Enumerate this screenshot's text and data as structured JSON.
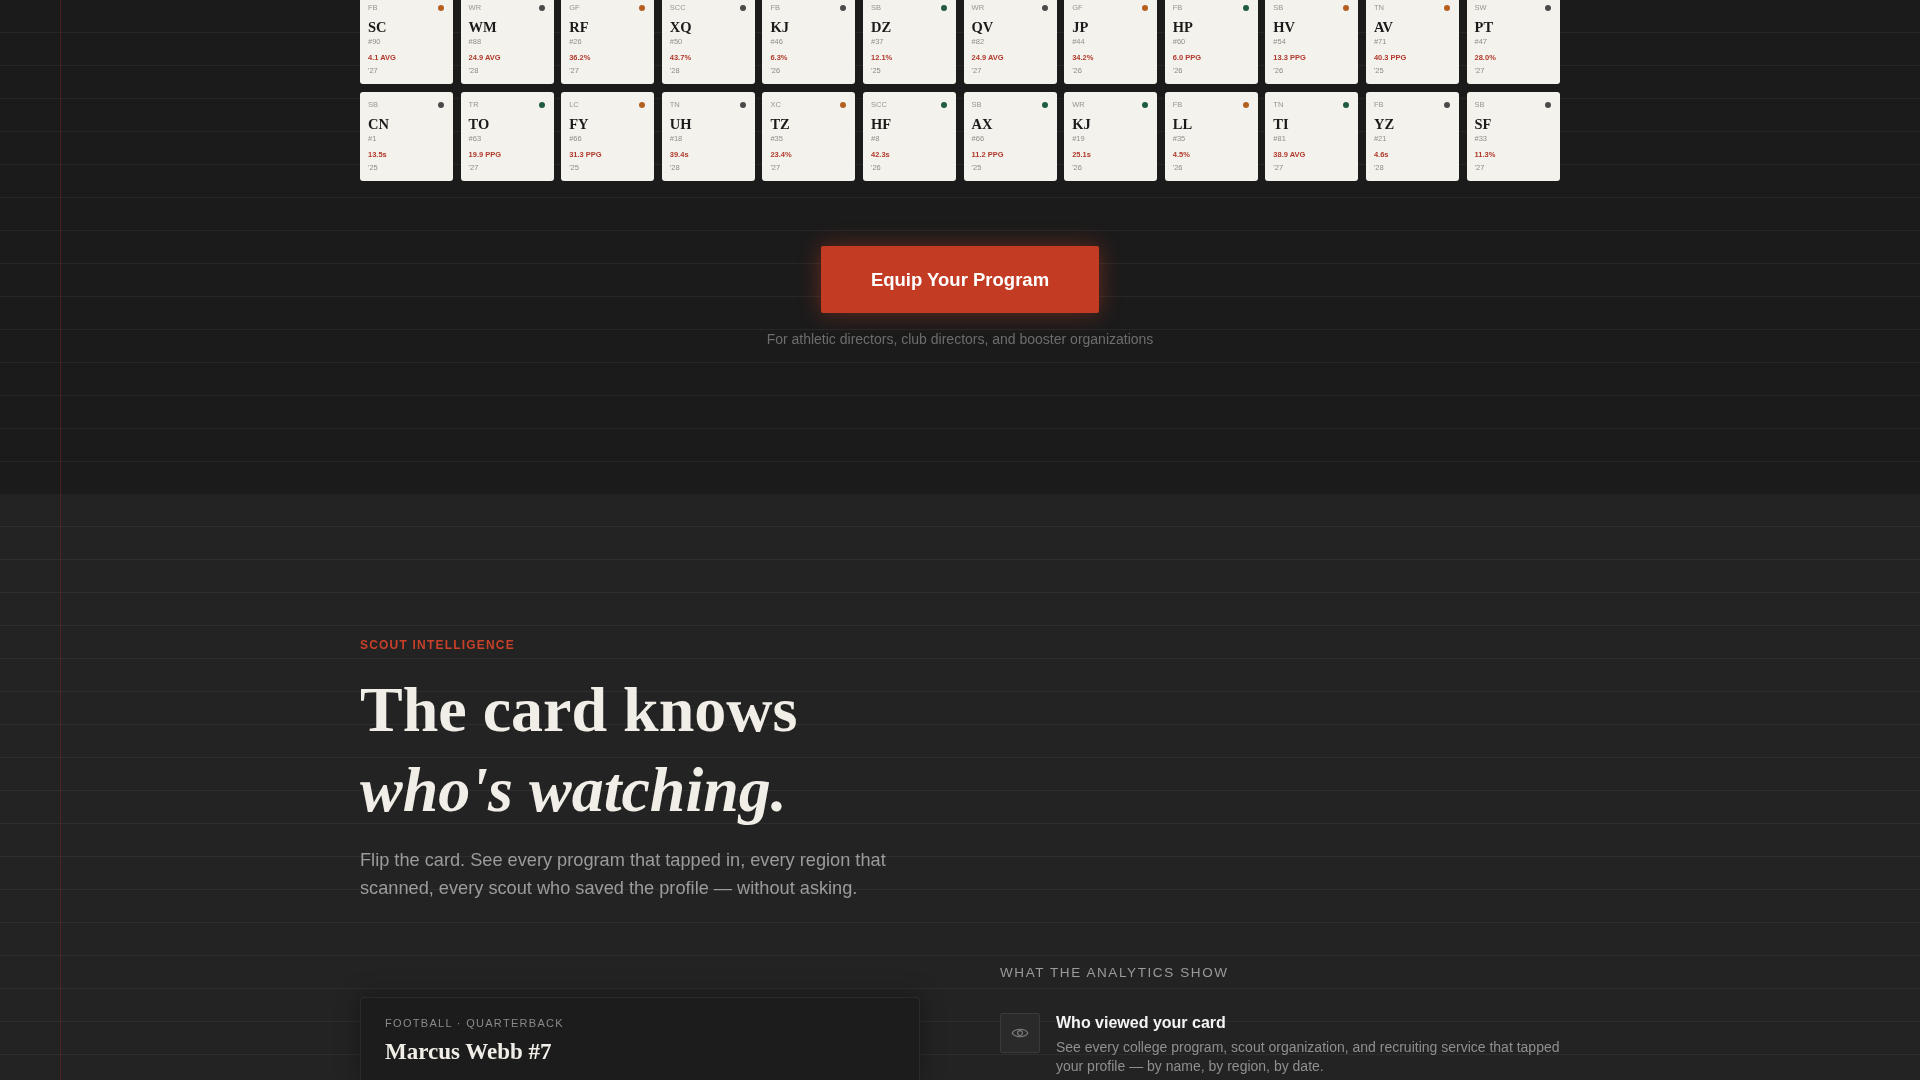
{
  "roster_cards": [
    {
      "sport": "FB",
      "initials": "SC",
      "number": "#90",
      "stat": "4.1 AVG",
      "class_year": "'27",
      "color": "#b5601f"
    },
    {
      "sport": "WR",
      "initials": "WM",
      "number": "#88",
      "stat": "24.9 AVG",
      "class_year": "'28",
      "color": "#4a4a4a"
    },
    {
      "sport": "GF",
      "initials": "RF",
      "number": "#26",
      "stat": "36.2%",
      "class_year": "'27",
      "color": "#b5601f"
    },
    {
      "sport": "SCC",
      "initials": "XQ",
      "number": "#50",
      "stat": "43.7%",
      "class_year": "'28",
      "color": "#4a4a4a"
    },
    {
      "sport": "FB",
      "initials": "KJ",
      "number": "#46",
      "stat": "6.3%",
      "class_year": "'26",
      "color": "#4a4a4a"
    },
    {
      "sport": "SB",
      "initials": "DZ",
      "number": "#37",
      "stat": "12.1%",
      "class_year": "'25",
      "color": "#1f5c3f"
    },
    {
      "sport": "WR",
      "initials": "QV",
      "number": "#82",
      "stat": "24.9 AVG",
      "class_year": "'27",
      "color": "#4a4a4a"
    },
    {
      "sport": "GF",
      "initials": "JP",
      "number": "#44",
      "stat": "34.2%",
      "class_year": "'26",
      "color": "#b5601f"
    },
    {
      "sport": "FB",
      "initials": "HP",
      "number": "#60",
      "stat": "6.0 PPG",
      "class_year": "'26",
      "color": "#1f5c3f"
    },
    {
      "sport": "SB",
      "initials": "HV",
      "number": "#54",
      "stat": "13.3 PPG",
      "class_year": "'26",
      "color": "#b5601f"
    },
    {
      "sport": "TN",
      "initials": "AV",
      "number": "#71",
      "stat": "40.3 PPG",
      "class_year": "'25",
      "color": "#b5601f"
    },
    {
      "sport": "SW",
      "initials": "PT",
      "number": "#47",
      "stat": "28.0%",
      "class_year": "'27",
      "color": "#4a4a4a"
    },
    {
      "sport": "SB",
      "initials": "CN",
      "number": "#1",
      "stat": "13.5s",
      "class_year": "'25",
      "color": "#4a4a4a"
    },
    {
      "sport": "TR",
      "initials": "TO",
      "number": "#63",
      "stat": "19.9 PPG",
      "class_year": "'27",
      "color": "#1f5c3f"
    },
    {
      "sport": "LC",
      "initials": "FY",
      "number": "#66",
      "stat": "31.3 PPG",
      "class_year": "'25",
      "color": "#b5601f"
    },
    {
      "sport": "TN",
      "initials": "UH",
      "number": "#18",
      "stat": "39.4s",
      "class_year": "'28",
      "color": "#4a4a4a"
    },
    {
      "sport": "XC",
      "initials": "TZ",
      "number": "#35",
      "stat": "23.4%",
      "class_year": "'27",
      "color": "#b5601f"
    },
    {
      "sport": "SCC",
      "initials": "HF",
      "number": "#8",
      "stat": "42.3s",
      "class_year": "'26",
      "color": "#1f5c3f"
    },
    {
      "sport": "SB",
      "initials": "AX",
      "number": "#66",
      "stat": "11.2 PPG",
      "class_year": "'25",
      "color": "#1f5c3f"
    },
    {
      "sport": "WR",
      "initials": "KJ",
      "number": "#19",
      "stat": "25.1s",
      "class_year": "'26",
      "color": "#1f5c3f"
    },
    {
      "sport": "FB",
      "initials": "LL",
      "number": "#35",
      "stat": "4.5%",
      "class_year": "'26",
      "color": "#b5601f"
    },
    {
      "sport": "TN",
      "initials": "TI",
      "number": "#81",
      "stat": "38.9 AVG",
      "class_year": "'27",
      "color": "#1f5c3f"
    },
    {
      "sport": "FB",
      "initials": "YZ",
      "number": "#21",
      "stat": "4.6s",
      "class_year": "'28",
      "color": "#4a4a4a"
    },
    {
      "sport": "SB",
      "initials": "SF",
      "number": "#33",
      "stat": "11.3%",
      "class_year": "'27",
      "color": "#4a4a4a"
    }
  ],
  "cta": {
    "button": "Equip Your Program",
    "note": "For athletic directors, club directors, and booster organizations"
  },
  "scout_section": {
    "eyebrow": "SCOUT INTELLIGENCE",
    "heading": "The card knows",
    "heading_emphasis": "who's watching.",
    "body": "Flip the card. See every program that tapped in, every region that scanned, every scout who saved the profile — without asking.",
    "profile_card": {
      "sport_position": "FOOTBALL · QUARTERBACK",
      "name": "Marcus Webb #7"
    },
    "analytics": {
      "title": "WHAT THE ANALYTICS SHOW",
      "features": [
        {
          "title": "Who viewed your card",
          "description": "See every college program, scout organization, and recruiting service that tapped your profile — by name, by region, by date."
        }
      ]
    }
  }
}
